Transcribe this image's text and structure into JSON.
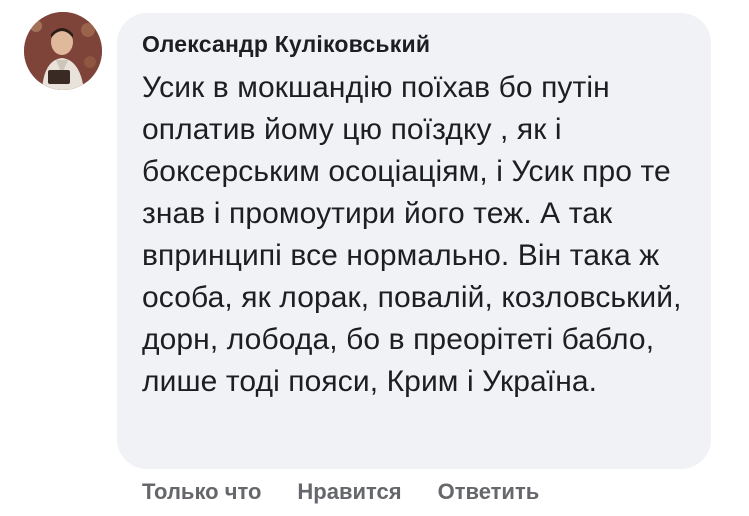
{
  "comment": {
    "author": "Олександр Куліковський",
    "text": "Усик в мокшандію поїхав бо путін оплатив йому цю поїздку , як і боксерським осоціаціям, і Усик про те знав і промоутири його теж. А так впринципі все нормально. Він така ж особа, як лорак, повалій, козловський, дорн, лобода, бо в преорітеті бабло, лише тоді пояси, Крим і Україна.",
    "avatar_icon": "user-photo-avatar"
  },
  "actions": {
    "time": "Только что",
    "like": "Нравится",
    "reply": "Ответить"
  },
  "colors": {
    "bubble": "#f0f2f5",
    "text": "#1c1e21",
    "meta": "#65676b"
  }
}
